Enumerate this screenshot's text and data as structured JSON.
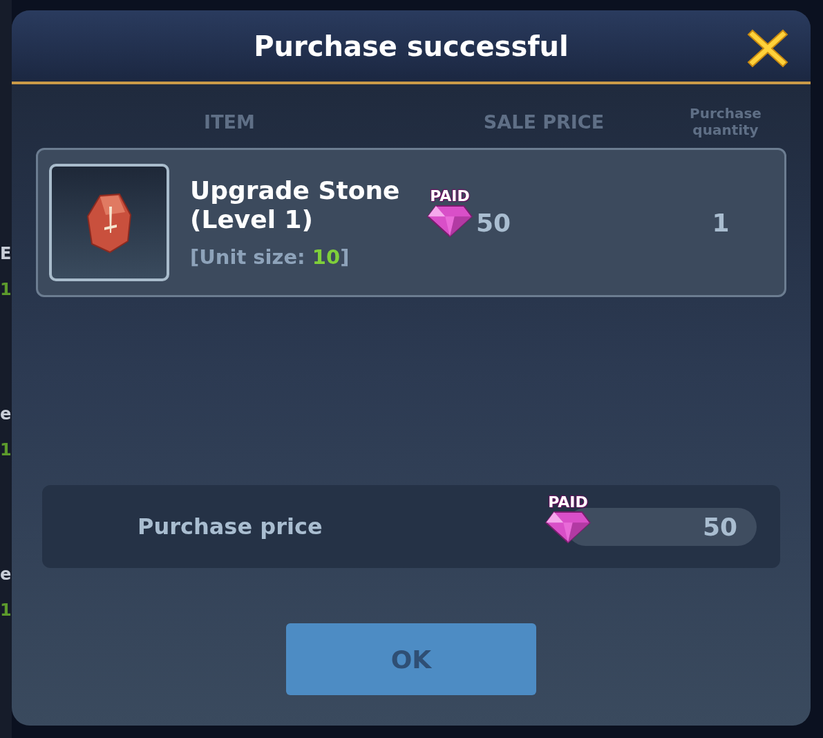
{
  "title": "Purchase successful",
  "columns": [
    "ITEM",
    "SALE PRICE",
    "Purchase quantity"
  ],
  "item": {
    "name": "Upgrade Stone (Level 1)",
    "unit_prefix": "[Unit size: ",
    "unit_size": "10",
    "unit_suffix": "]",
    "price_tag": "PAID",
    "price": "50",
    "quantity": "1"
  },
  "total": {
    "label": "Purchase price",
    "price_tag": "PAID",
    "amount": "50"
  },
  "button": "OK",
  "background_rows": [
    {
      "label": "E",
      "value": "1"
    },
    {
      "label": "e",
      "value": "1"
    },
    {
      "label": "e",
      "value": "1"
    }
  ]
}
